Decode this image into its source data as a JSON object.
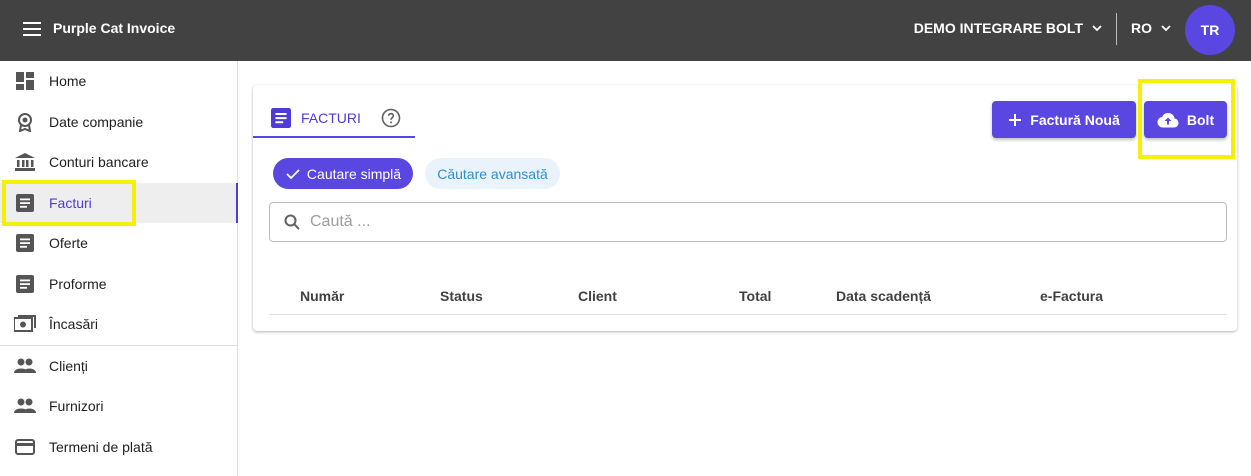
{
  "header": {
    "app_title": "Purple Cat Invoice",
    "company": "DEMO INTEGRARE BOLT",
    "language": "RO",
    "avatar_initials": "TR"
  },
  "sidebar": {
    "items": [
      {
        "label": "Home",
        "icon": "dashboard-icon"
      },
      {
        "label": "Date companie",
        "icon": "award-icon"
      },
      {
        "label": "Conturi bancare",
        "icon": "bank-icon"
      },
      {
        "label": "Facturi",
        "icon": "document-icon",
        "active": true
      },
      {
        "label": "Oferte",
        "icon": "document-icon"
      },
      {
        "label": "Proforme",
        "icon": "document-icon"
      },
      {
        "label": "Încasări",
        "icon": "cash-icon"
      },
      {
        "label": "Clienți",
        "icon": "people-icon"
      },
      {
        "label": "Furnizori",
        "icon": "people-icon"
      },
      {
        "label": "Termeni de plată",
        "icon": "credit-card-icon"
      }
    ]
  },
  "main": {
    "tab_label": "FACTURI",
    "new_invoice_label": "Factură Nouă",
    "bolt_label": "Bolt",
    "chip_simple": "Cautare simplă",
    "chip_advanced": "Căutare avansată",
    "search_placeholder": "Caută ...",
    "columns": [
      "Număr",
      "Status",
      "Client",
      "Total",
      "Data scadență",
      "e-Factura"
    ]
  },
  "colors": {
    "topbar": "#424242",
    "accent": "#5a46e0",
    "highlight": "#f5f00a"
  }
}
